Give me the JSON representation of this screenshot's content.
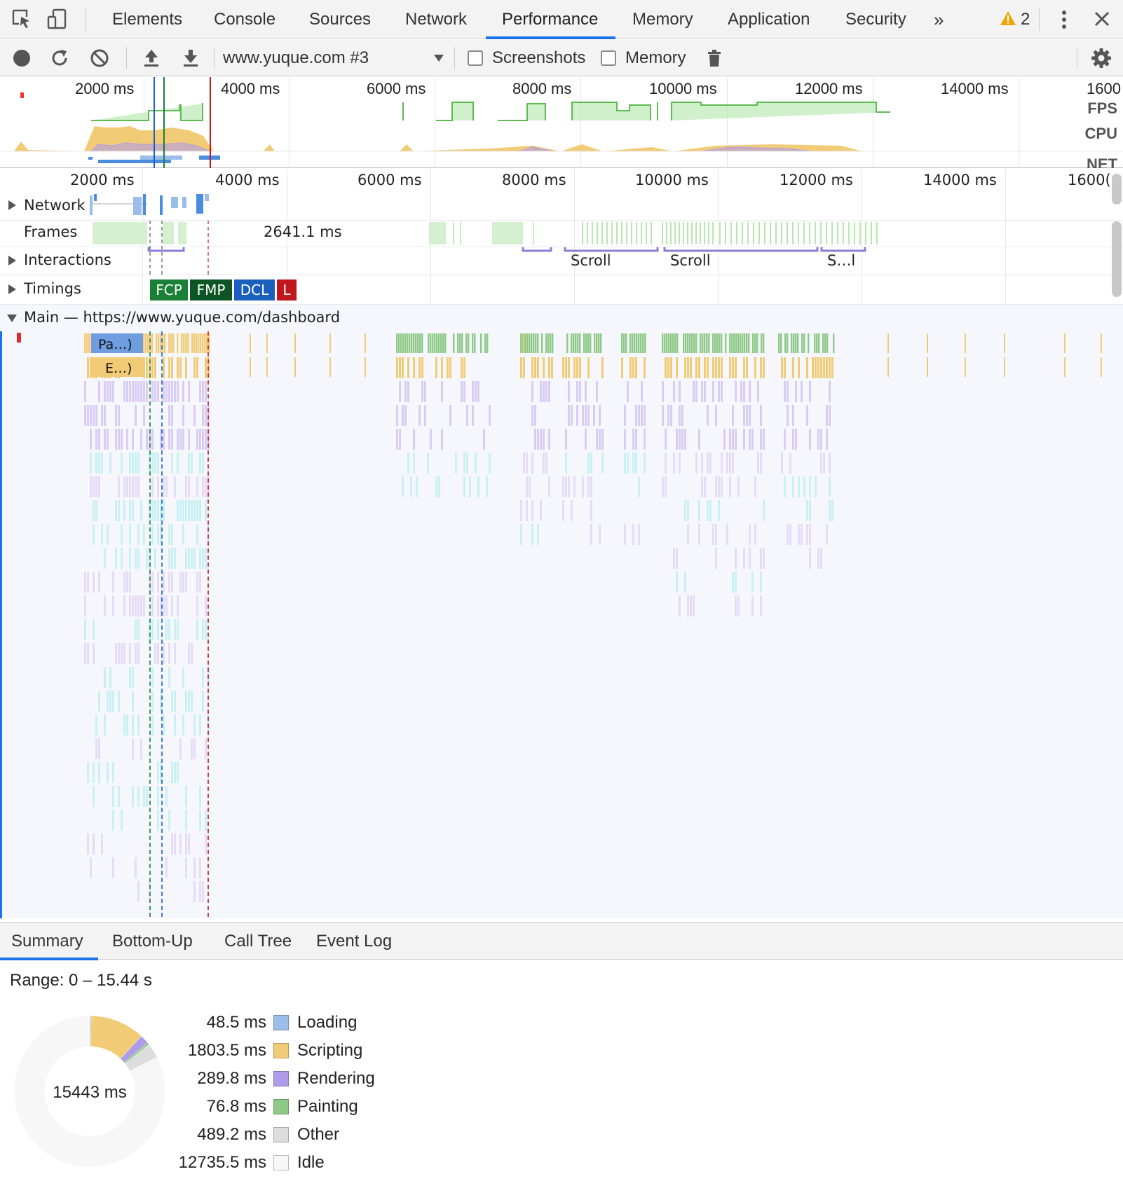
{
  "tabs": {
    "items": [
      "Elements",
      "Console",
      "Sources",
      "Network",
      "Performance",
      "Memory",
      "Application",
      "Security"
    ],
    "active": "Performance",
    "more": "»",
    "warnings_count": "2"
  },
  "toolbar": {
    "profile_select": "www.yuque.com #3",
    "screenshots_label": "Screenshots",
    "memory_label": "Memory"
  },
  "overview": {
    "ticks": [
      "2000 ms",
      "4000 ms",
      "6000 ms",
      "8000 ms",
      "10000 ms",
      "12000 ms",
      "14000 ms",
      "1600"
    ],
    "fps_label": "FPS",
    "cpu_label": "CPU",
    "net_label": "NET"
  },
  "ruler": {
    "ticks": [
      "2000 ms",
      "4000 ms",
      "6000 ms",
      "8000 ms",
      "10000 ms",
      "12000 ms",
      "14000 ms",
      "1600("
    ]
  },
  "tracks": {
    "network": "Network",
    "frames": "Frames",
    "frames_long_label": "2641.1 ms",
    "interactions": "Interactions",
    "interaction_labels": [
      "Scroll",
      "Scroll",
      "S…l"
    ],
    "timings": "Timings",
    "timing_badges": [
      "FCP",
      "FMP",
      "DCL",
      "L"
    ],
    "main": "Main — https://www.yuque.com/dashboard",
    "main_event_1": "Pa…)",
    "main_event_2": "E…)"
  },
  "bottom": {
    "tabs": [
      "Summary",
      "Bottom-Up",
      "Call Tree",
      "Event Log"
    ],
    "active_tab": "Summary",
    "range": "Range: 0 – 15.44 s",
    "total": "15443 ms",
    "categories": [
      {
        "value": "48.5 ms",
        "name": "Loading",
        "ms": 48.5,
        "color": "#9bbdea"
      },
      {
        "value": "1803.5 ms",
        "name": "Scripting",
        "ms": 1803.5,
        "color": "#f2cb77"
      },
      {
        "value": "289.8 ms",
        "name": "Rendering",
        "ms": 289.8,
        "color": "#af9ce8"
      },
      {
        "value": "76.8 ms",
        "name": "Painting",
        "ms": 76.8,
        "color": "#8ec987"
      },
      {
        "value": "489.2 ms",
        "name": "Other",
        "ms": 489.2,
        "color": "#dddddd"
      },
      {
        "value": "12735.5 ms",
        "name": "Idle",
        "ms": 12735.5,
        "color": "#f7f7f7"
      }
    ]
  },
  "colors": {
    "accent": "#1a73e8",
    "fcp": "#1a7f37",
    "fmp": "#0d5524",
    "dcl": "#1a5fbd",
    "load": "#c0161c",
    "scripting": "#f2cb77",
    "rendering": "#d9cdf4",
    "painting": "#8ec987",
    "fps_green": "#8ed07f",
    "interaction": "#8c7ed6",
    "warning": "#f2a500"
  }
}
